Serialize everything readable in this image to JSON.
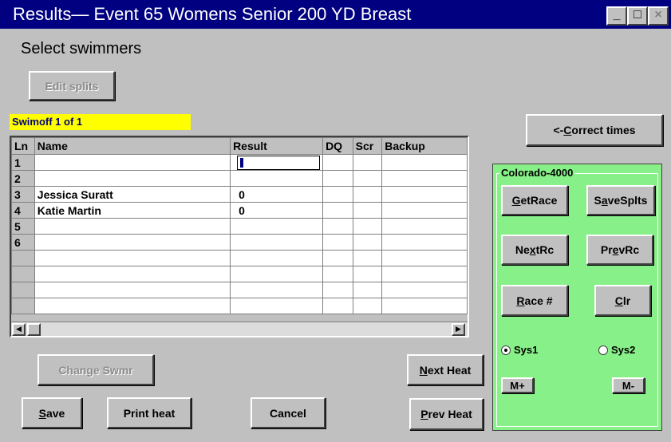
{
  "window": {
    "title": "Results— Event 65 Womens  Senior 200 YD Breast",
    "minimize": "_",
    "maximize": "□",
    "close": "×"
  },
  "subtitle": "Select swimmers",
  "edit_splits_label": "Edit splits",
  "heat_label": "Swimoff 1 of 1",
  "correct_times": {
    "prefix": "<-",
    "hotkey": "C",
    "rest": "orrect times"
  },
  "grid": {
    "columns": [
      "Ln",
      "Name",
      "Result",
      "DQ",
      "Scr",
      "Backup"
    ],
    "rows": [
      {
        "ln": "1",
        "name": "",
        "result": "",
        "dq": "",
        "scr": "",
        "backup": ""
      },
      {
        "ln": "2",
        "name": "",
        "result": "",
        "dq": "",
        "scr": "",
        "backup": ""
      },
      {
        "ln": "3",
        "name": "Jessica Suratt",
        "result": "0",
        "dq": "",
        "scr": "",
        "backup": ""
      },
      {
        "ln": "4",
        "name": "Katie Martin",
        "result": "0",
        "dq": "",
        "scr": "",
        "backup": ""
      },
      {
        "ln": "5",
        "name": "",
        "result": "",
        "dq": "",
        "scr": "",
        "backup": ""
      },
      {
        "ln": "6",
        "name": "",
        "result": "",
        "dq": "",
        "scr": "",
        "backup": ""
      },
      {
        "ln": "",
        "name": "",
        "result": "",
        "dq": "",
        "scr": "",
        "backup": ""
      },
      {
        "ln": "",
        "name": "",
        "result": "",
        "dq": "",
        "scr": "",
        "backup": ""
      },
      {
        "ln": "",
        "name": "",
        "result": "",
        "dq": "",
        "scr": "",
        "backup": ""
      },
      {
        "ln": "",
        "name": "",
        "result": "",
        "dq": "",
        "scr": "",
        "backup": ""
      }
    ]
  },
  "buttons": {
    "change_swmr": "Change Swmr",
    "next_heat": {
      "hotkey": "N",
      "rest": "ext Heat"
    },
    "save": {
      "hotkey": "S",
      "rest": "ave"
    },
    "print_heat": "Print heat",
    "cancel": "Cancel",
    "prev_heat": {
      "hotkey": "P",
      "rest": "rev Heat"
    }
  },
  "timer_panel": {
    "label": "Colorado-4000",
    "get_race": {
      "hotkey": "G",
      "rest": "etRace"
    },
    "save_splits": {
      "pre": "S",
      "hotkey": "a",
      "rest": "veSplts"
    },
    "next_race": {
      "pre": "Ne",
      "hotkey": "x",
      "rest": "tRc"
    },
    "prev_race": {
      "pre": "Pr",
      "hotkey": "e",
      "rest": "vRc"
    },
    "race_num": {
      "hotkey": "R",
      "rest": "ace #"
    },
    "clear": {
      "hotkey": "C",
      "rest": "lr"
    },
    "sys1": "Sys1",
    "sys2": "Sys2",
    "m_plus": "M+",
    "m_minus": "M-"
  },
  "scroll": {
    "left": "◀",
    "right": "▶"
  },
  "colors": {
    "title_bg": "#000080",
    "panel_green": "#88f088",
    "heat_yellow": "#ffff00"
  }
}
